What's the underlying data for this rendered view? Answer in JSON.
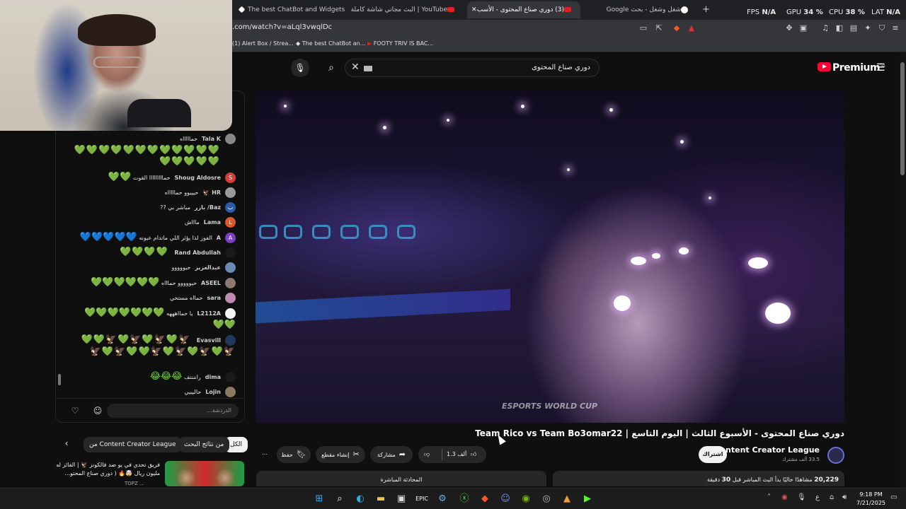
{
  "browser": {
    "tabs": [
      {
        "label": "The best ChatBot and Widgets for Ki"
      },
      {
        "label": "YouTube | البث مجاني شاشة كاملة -"
      },
      {
        "label": "(3) دوري صناع المحتوى - الأسب"
      },
      {
        "label": "شغل وشغل - بحث Google"
      }
    ],
    "new_tab": "+",
    "stats": [
      {
        "label": "FPS",
        "value": "N/A"
      },
      {
        "label": "GPU",
        "value": "34 %"
      },
      {
        "label": "CPU",
        "value": "38 %"
      },
      {
        "label": "LAT",
        "value": "N/A"
      }
    ],
    "url": ".com/watch?v=aLql3vwqlDc",
    "bookmarks": [
      "(1) Alert Box / Strea...",
      "The best ChatBot an...",
      "FOOTY TRIV IS BAC..."
    ]
  },
  "masthead": {
    "search_value": "دوري صناع المحتوى",
    "logo_text": "Premium",
    "logo_region": "SA"
  },
  "chat": {
    "messages": [
      {
        "author": "Tala K",
        "text": "حماااااه",
        "hearts": "💚💚💚💚💚💚💚💚💚💚💚💚💚💚💚💚💚",
        "avatar_color": "#888888",
        "avatar_letter": ""
      },
      {
        "author": "Shoug Aldosre",
        "text": "حمااااااااا القوت",
        "hearts": "💚💚",
        "avatar_color": "#d6403a",
        "avatar_letter": "S"
      },
      {
        "author": "HR 🦅",
        "text": "حيييوو حماااااه",
        "hearts": "",
        "avatar_color": "#9a9a9a",
        "avatar_letter": ""
      },
      {
        "author": "Baz/ بازر",
        "text": "مباشر بي ??",
        "hearts": "",
        "avatar_color": "#2a5aa8",
        "avatar_letter": "ب"
      },
      {
        "author": "Lama",
        "text": "ماااش",
        "hearts": "",
        "avatar_color": "#e0552a",
        "avatar_letter": "L"
      },
      {
        "author": "A",
        "text": "الفوز لذا يؤثر اللي ماتدام عيونه",
        "hearts": "💙💙💙💙💙",
        "avatar_color": "#7b3fc4",
        "avatar_letter": "A"
      },
      {
        "author": "Rand Abdullah",
        "text": "",
        "hearts": "💚💚💚💚",
        "avatar_color": "#1a1a1a",
        "avatar_letter": ""
      },
      {
        "author": "عبدالعزيز",
        "text": "حيووووو",
        "hearts": "",
        "avatar_color": "#6a8ab0",
        "avatar_letter": ""
      },
      {
        "author": "ASEEL",
        "text": "حيووووو حماااه",
        "hearts": "💚💚💚💚💚💚",
        "avatar_color": "#8a7a70",
        "avatar_letter": ""
      },
      {
        "author": "sara",
        "text": "حمااه مستحي",
        "hearts": "",
        "avatar_color": "#c08ab0",
        "avatar_letter": ""
      },
      {
        "author": "L2112A",
        "text": "يا حمااهههه",
        "hearts": "💚💚💚💚💚💚💚💚💚",
        "avatar_color": "#f4f4f4",
        "avatar_letter": ""
      },
      {
        "author": "Evasvill",
        "text": "",
        "hearts": "🦅💚🦅💚🦅💚🦅💚💚🦅💚🦅💚🦅💚🦅💚💚🦅💚🦅",
        "avatar_color": "#1f3a5a",
        "avatar_letter": ""
      },
      {
        "author": "dima",
        "text": "راننننف",
        "hearts": "😂😂😂",
        "avatar_color": "#1a1a1a",
        "avatar_letter": ""
      },
      {
        "author": "Lojin",
        "text": "حاليييي",
        "hearts": "",
        "avatar_color": "#8a7a60",
        "avatar_letter": ""
      }
    ],
    "input_placeholder": "الدردشة..."
  },
  "video": {
    "watermark": "ESPORTS WORLD CUP",
    "title": "دوري صناع المحتوى - الأسبوع الثالث | اليوم التاسع | Team Rico vs Team Bo3omar22",
    "channel_name": "Content Creator League",
    "channel_subs": "33.5 ألف مشترك",
    "subscribe_label": "اشتراك",
    "likes": "1.3 ألف",
    "share_label": "مشاركة",
    "clip_label": "إنشاء مقطع",
    "save_label": "حفظ",
    "more_label": "⋯",
    "views_count": "20,229",
    "views_text": "مشاهدًا حاليًا  بدأ البث المباشر قبل",
    "started_value": "30",
    "started_unit": "دقيقة",
    "livechat_replay": "المحادثة المباشرة"
  },
  "chips": {
    "all": "الكل",
    "from_search": "من نتائج البحث",
    "from_channel": "من Content Creator League"
  },
  "recommendation": {
    "title": "فريق تحدي في يو ضد فالكونز 🦅 | الفائز له مليون ريال 🤯🔥 ( دوري صناع المحتو...",
    "meta": "TOPZ ..."
  },
  "taskbar": {
    "time": "9:18 PM",
    "date": "7/21/2025",
    "lang": "ع"
  }
}
